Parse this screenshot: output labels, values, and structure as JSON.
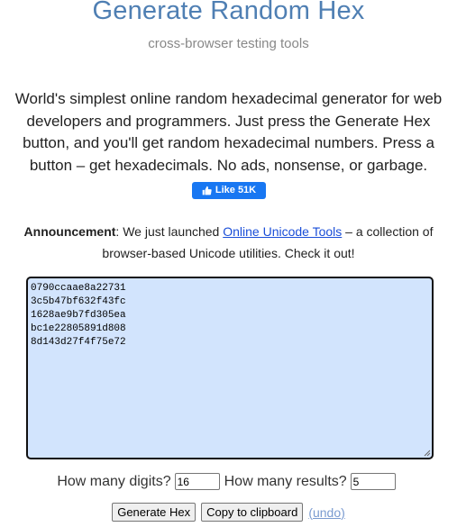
{
  "header": {
    "title": "Generate Random Hex",
    "subtitle": "cross-browser testing tools"
  },
  "intro": {
    "text": "World's simplest online random hexadecimal generator for web developers and programmers. Just press the Generate Hex button, and you'll get random hexadecimal numbers. Press a button – get hexadecimals. No ads, nonsense, or garbage."
  },
  "like_button": {
    "label": "Like 51K",
    "icon": "thumbs-up-icon",
    "color": "#1877f2"
  },
  "announcement": {
    "label": "Announcement",
    "text_before": ": We just launched ",
    "link_text": "Online Unicode Tools",
    "text_after": " – a collection of browser-based Unicode utilities. Check it out!"
  },
  "output": {
    "lines": [
      "0790ccaae8a22731",
      "3c5b47bf632f43fc",
      "1628ae9b7fd305ea",
      "bc1e22805891d808",
      "8d143d27f4f75e72"
    ],
    "background": "#d2e4fd"
  },
  "controls": {
    "digits_label": "How many digits?",
    "digits_value": "16",
    "results_label": "How many results?",
    "results_value": "5"
  },
  "buttons": {
    "generate": "Generate Hex",
    "copy": "Copy to clipboard",
    "undo": "(undo)"
  }
}
